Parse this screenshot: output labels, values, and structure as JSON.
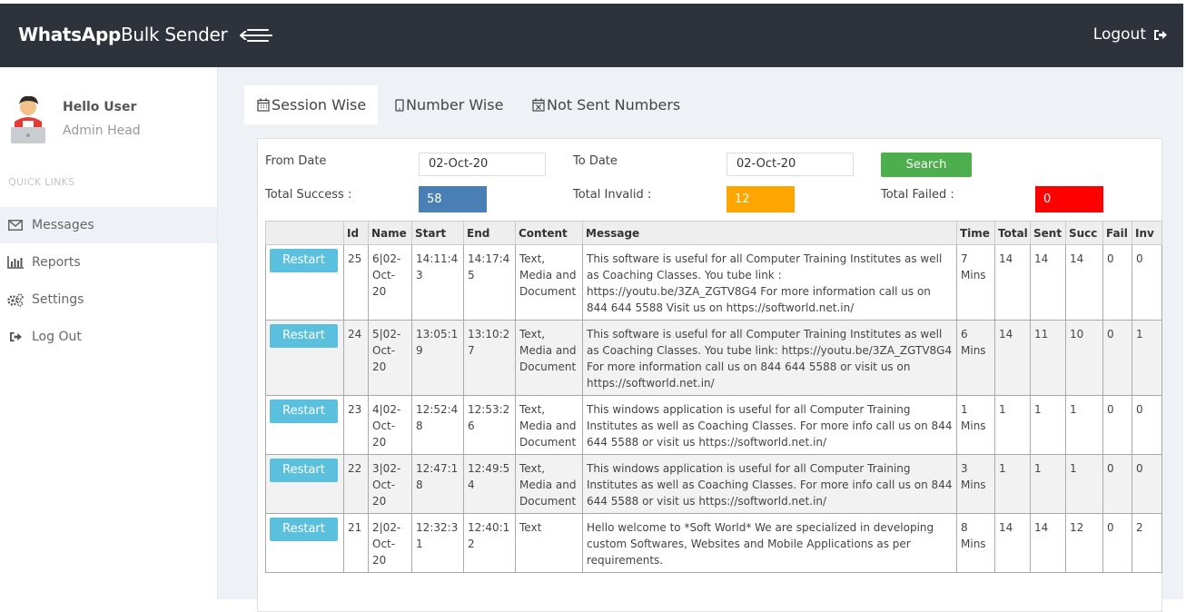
{
  "navbar": {
    "brand_bold": "WhatsApp",
    "brand_rest": "Bulk Sender",
    "logout_label": "Logout"
  },
  "sidebar": {
    "user_name": "Hello User",
    "user_role": "Admin Head",
    "section_label": "QUICK LINKS",
    "items": [
      {
        "label": "Messages",
        "icon": "envelope-icon",
        "active": true
      },
      {
        "label": "Reports",
        "icon": "bar-chart-icon"
      },
      {
        "label": "Settings",
        "icon": "gears-icon"
      },
      {
        "label": "Log Out",
        "icon": "sign-out-icon"
      }
    ]
  },
  "tabs": [
    {
      "label": "Session Wise",
      "icon": "calendar-icon",
      "active": true
    },
    {
      "label": "Number Wise",
      "icon": "mobile-icon"
    },
    {
      "label": "Not Sent Numbers",
      "icon": "calendar-times-icon"
    }
  ],
  "filters": {
    "from_label": "From Date",
    "from_value": "02-Oct-20",
    "to_label": "To Date",
    "to_value": "02-Oct-20",
    "search_label": "Search"
  },
  "totals": {
    "success_label": "Total Success :",
    "success_value": "58",
    "success_color": "#4a7fb5",
    "invalid_label": "Total Invalid :",
    "invalid_value": "12",
    "invalid_color": "#ffa500",
    "failed_label": "Total Failed :",
    "failed_value": "0",
    "failed_color": "#ff0000"
  },
  "table": {
    "headers": [
      "",
      "Id",
      "Name",
      "Start",
      "End",
      "Content",
      "Message",
      "Time",
      "Total",
      "Sent",
      "Succ",
      "Fail",
      "Inv"
    ],
    "restart_label": "Restart",
    "rows": [
      {
        "id": "25",
        "name": "6|02-Oct-20",
        "start": "14:11:43",
        "end": "14:17:45",
        "content": "Text, Media and Document",
        "message": "This software is useful for all Computer Training Institutes as well as Coaching Classes. You tube link : https://youtu.be/3ZA_ZGTV8G4 For more information call us on 844 644 5588 Visit us on https://softworld.net.in/",
        "time": "7 Mins",
        "total": "14",
        "sent": "14",
        "succ": "14",
        "fail": "0",
        "inv": "0"
      },
      {
        "id": "24",
        "name": "5|02-Oct-20",
        "start": "13:05:19",
        "end": "13:10:27",
        "content": "Text, Media and Document",
        "message": "This software is useful for all Computer Training Institutes as well as Coaching Classes. You tube link: https://youtu.be/3ZA_ZGTV8G4 For more information call us on 844 644 5588 or visit us on https://softworld.net.in/",
        "time": "6 Mins",
        "total": "14",
        "sent": "11",
        "succ": "10",
        "fail": "0",
        "inv": "1"
      },
      {
        "id": "23",
        "name": "4|02-Oct-20",
        "start": "12:52:48",
        "end": "12:53:26",
        "content": "Text, Media and Document",
        "message": "This windows application is useful for all Computer Training Institutes as well as Coaching Classes. For more info call us on 844 644 5588 or visit us https://softworld.net.in/",
        "time": "1 Mins",
        "total": "1",
        "sent": "1",
        "succ": "1",
        "fail": "0",
        "inv": "0"
      },
      {
        "id": "22",
        "name": "3|02-Oct-20",
        "start": "12:47:18",
        "end": "12:49:54",
        "content": "Text, Media and Document",
        "message": "This windows application is useful for all Computer Training Institutes as well as Coaching Classes. For more info call us on 844 644 5588 or visit us https://softworld.net.in/",
        "time": "3 Mins",
        "total": "1",
        "sent": "1",
        "succ": "1",
        "fail": "0",
        "inv": "0"
      },
      {
        "id": "21",
        "name": "2|02-Oct-20",
        "start": "12:32:31",
        "end": "12:40:12",
        "content": "Text",
        "message": "Hello welcome to *Soft World* We are specialized in developing custom Softwares, Websites and Mobile Applications as per requirements.",
        "time": "8 Mins",
        "total": "14",
        "sent": "14",
        "succ": "12",
        "fail": "0",
        "inv": "2"
      }
    ]
  }
}
